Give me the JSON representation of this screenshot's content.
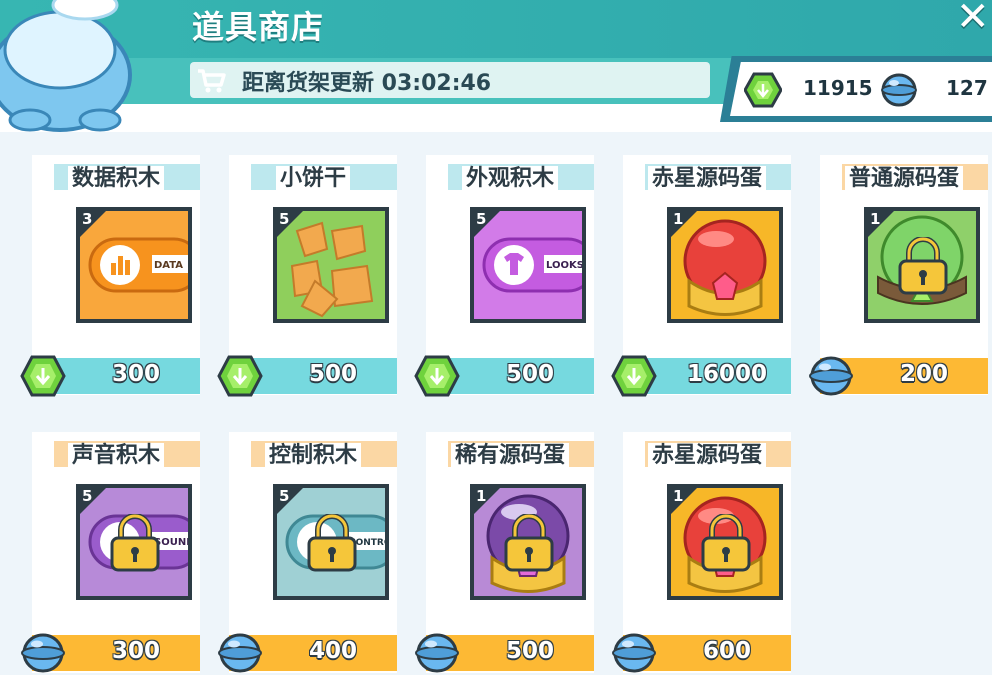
{
  "shop": {
    "title": "道具商店",
    "close_glyph": "✕",
    "refresh_text": "距离货架更新 03:02:46"
  },
  "wallet": {
    "gems": "11915",
    "orbs": "127"
  },
  "colors": {
    "teal": "#37b6b2",
    "price_cyan": "#76d9df",
    "price_orange": "#fdb934",
    "dark": "#2d3c45"
  },
  "items": [
    {
      "name": "数据积木",
      "count": "3",
      "price": "300",
      "currency": "gem-icon",
      "locked": false,
      "tile": "data-block"
    },
    {
      "name": "小饼干",
      "count": "5",
      "price": "500",
      "currency": "gem-icon",
      "locked": false,
      "tile": "cookie"
    },
    {
      "name": "外观积木",
      "count": "5",
      "price": "500",
      "currency": "gem-icon",
      "locked": false,
      "tile": "looks-block"
    },
    {
      "name": "赤星源码蛋",
      "count": "1",
      "price": "16000",
      "currency": "gem-icon",
      "locked": false,
      "tile": "red-egg"
    },
    {
      "name": "普通源码蛋",
      "count": "1",
      "price": "200",
      "currency": "orb-icon",
      "locked": true,
      "tile": "green-egg"
    },
    {
      "name": "声音积木",
      "count": "5",
      "price": "300",
      "currency": "orb-icon",
      "locked": true,
      "tile": "sound-block"
    },
    {
      "name": "控制积木",
      "count": "5",
      "price": "400",
      "currency": "orb-icon",
      "locked": true,
      "tile": "control-block"
    },
    {
      "name": "稀有源码蛋",
      "count": "1",
      "price": "500",
      "currency": "orb-icon",
      "locked": true,
      "tile": "purple-egg"
    },
    {
      "name": "赤星源码蛋",
      "count": "1",
      "price": "600",
      "currency": "orb-icon",
      "locked": true,
      "tile": "red-egg"
    }
  ]
}
